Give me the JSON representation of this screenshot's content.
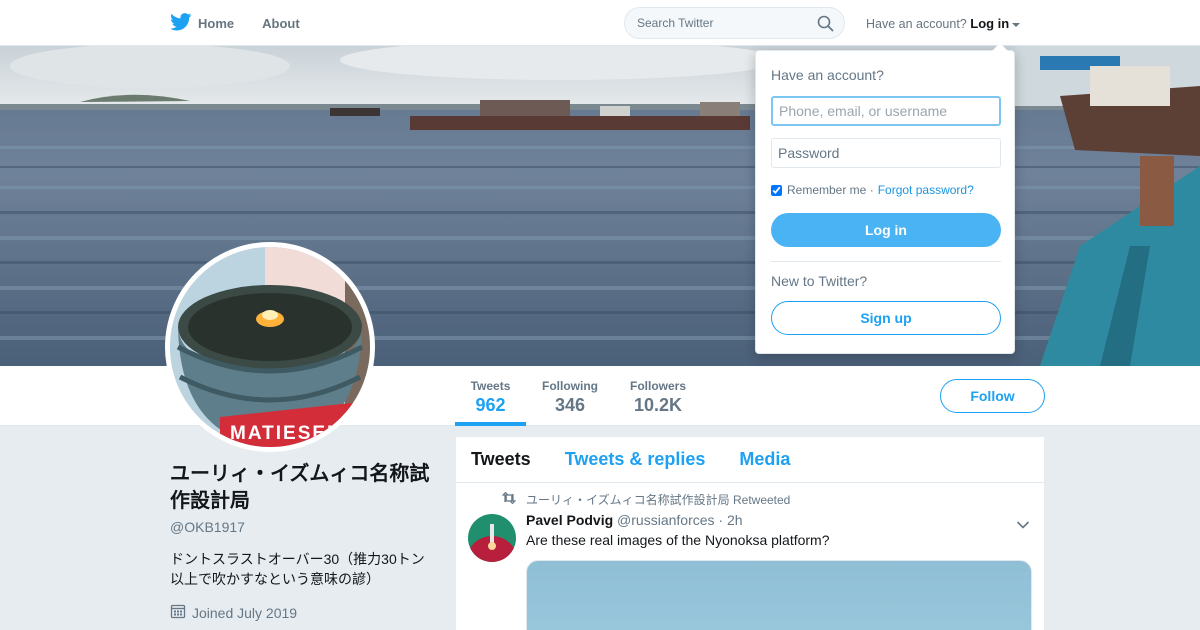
{
  "nav": {
    "home_label": "Home",
    "about_label": "About",
    "search_placeholder": "Search Twitter",
    "have_account_text": "Have an account?",
    "login_label": "Log in"
  },
  "colors": {
    "brand_blue": "#1da1f2",
    "login_button": "#4ab3f4",
    "text_secondary": "#657786",
    "page_background": "#e6ecf0"
  },
  "icons": [
    "twitter-bird-icon",
    "search-icon",
    "caret-down-icon",
    "calendar-icon",
    "retweet-icon",
    "chevron-down-icon"
  ],
  "profile": {
    "name": "ユーリィ・イズムィコ名称試作設計局",
    "handle": "@OKB1917",
    "bio": "ドントスラストオーバー30（推力30トン以上で吹かすなという意味の諺）",
    "joined": "Joined July 2019",
    "avatar_sign_text": "MATIESEN"
  },
  "stats": [
    {
      "label": "Tweets",
      "value": "962",
      "active": true
    },
    {
      "label": "Following",
      "value": "346",
      "active": false
    },
    {
      "label": "Followers",
      "value": "10.2K",
      "active": false
    }
  ],
  "follow_label": "Follow",
  "timeline": {
    "tabs": [
      {
        "label": "Tweets",
        "active": true
      },
      {
        "label": "Tweets & replies",
        "active": false
      },
      {
        "label": "Media",
        "active": false
      }
    ],
    "tweet": {
      "retweeted_by": "ユーリィ・イズムィコ名称試作設計局 Retweeted",
      "fullname": "Pavel Podvig",
      "username": "@russianforces",
      "time": "· 2h",
      "text": "Are these real images of the Nyonoksa platform?"
    }
  },
  "login_dropdown": {
    "title": "Have an account?",
    "username_placeholder": "Phone, email, or username",
    "password_placeholder": "Password",
    "remember_label": "Remember me",
    "separator": "·",
    "forgot_label": "Forgot password?",
    "login_button_label": "Log in",
    "new_to_label": "New to Twitter?",
    "signup_label": "Sign up"
  }
}
